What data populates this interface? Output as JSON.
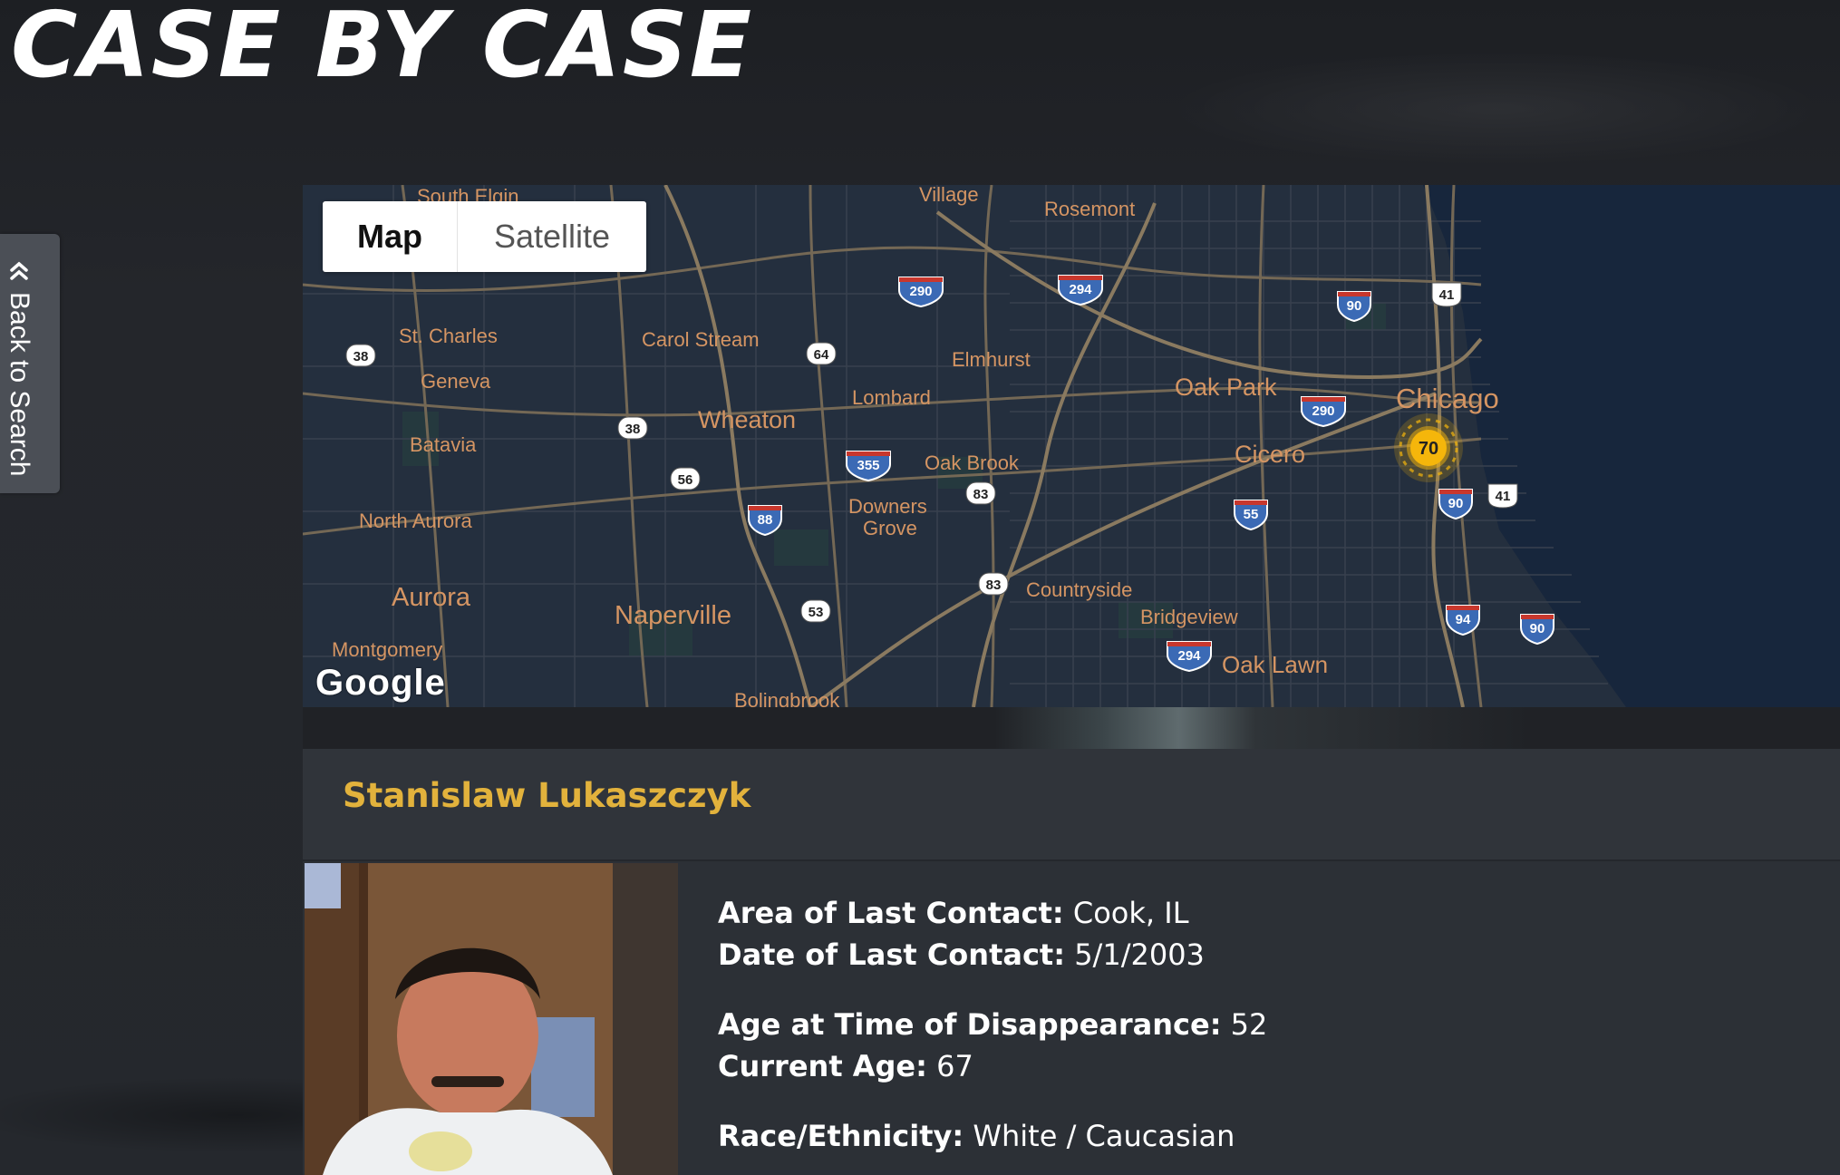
{
  "site": {
    "title": "CASE BY CASE"
  },
  "back_tab": {
    "label": "Back to Search",
    "icon": "double-chevron-left-icon"
  },
  "map": {
    "toggle": {
      "map_label": "Map",
      "satellite_label": "Satellite",
      "selected": "Map"
    },
    "attribution": "Google",
    "cluster": {
      "count": "70",
      "color": "#f5b60b"
    },
    "places": [
      "South Elgin",
      "Village",
      "Rosemont",
      "St. Charles",
      "Carol Stream",
      "Elmhurst",
      "Geneva",
      "Lombard",
      "Oak Park",
      "Chicago",
      "Wheaton",
      "Batavia",
      "Oak Brook",
      "Cicero",
      "Downers",
      "Grove",
      "North Aurora",
      "Aurora",
      "Countryside",
      "Bridgeview",
      "Naperville",
      "Montgomery",
      "Oak Lawn",
      "Bolingbrook"
    ],
    "route_shields": {
      "interstate": [
        "290",
        "294",
        "90",
        "290",
        "355",
        "88",
        "90",
        "55",
        "94",
        "294",
        "90"
      ],
      "state": [
        "38",
        "64",
        "38",
        "56",
        "83",
        "83",
        "53",
        "41",
        "41"
      ]
    }
  },
  "case": {
    "name": "Stanislaw Lukaszczyk",
    "fields": [
      {
        "label": "Area of Last Contact:",
        "value": "Cook, IL"
      },
      {
        "label": "Date of Last Contact:",
        "value": "5/1/2003"
      },
      {
        "label": "Age at Time of Disappearance:",
        "value": "52"
      },
      {
        "label": "Current Age:",
        "value": "67"
      },
      {
        "label": "Race/Ethnicity:",
        "value": "White / Caucasian"
      }
    ]
  }
}
